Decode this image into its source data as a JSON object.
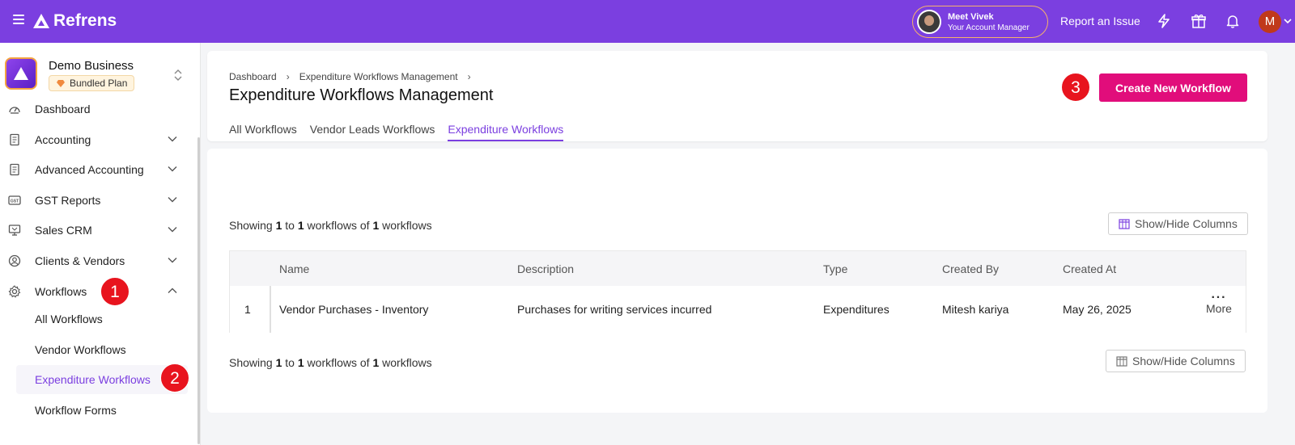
{
  "topbar": {
    "brand": "Refrens",
    "manager_name": "Meet Vivek",
    "manager_role": "Your Account Manager",
    "report_label": "Report an Issue",
    "user_initial": "M",
    "accent_color": "#7b3fe0"
  },
  "sidebar": {
    "business_name": "Demo Business",
    "plan_label": "Bundled Plan",
    "items": [
      {
        "label": "Dashboard",
        "icon": "dashboard-icon"
      },
      {
        "label": "Accounting",
        "icon": "document-icon"
      },
      {
        "label": "Advanced Accounting",
        "icon": "document-icon"
      },
      {
        "label": "GST Reports",
        "icon": "gst-icon"
      },
      {
        "label": "Sales CRM",
        "icon": "monitor-icon"
      },
      {
        "label": "Clients & Vendors",
        "icon": "user-circle-icon"
      },
      {
        "label": "Workflows",
        "icon": "gear-icon"
      }
    ],
    "workflow_subitems": [
      {
        "label": "All Workflows"
      },
      {
        "label": "Vendor Workflows"
      },
      {
        "label": "Expenditure Workflows"
      },
      {
        "label": "Workflow Forms"
      }
    ]
  },
  "markers": [
    "1",
    "2",
    "3"
  ],
  "header": {
    "breadcrumbs": [
      "Dashboard",
      "Expenditure Workflows Management"
    ],
    "title": "Expenditure Workflows Management",
    "tabs": [
      "All Workflows",
      "Vendor Leads Workflows",
      "Expenditure Workflows"
    ],
    "active_tab": "Expenditure Workflows",
    "create_button": "Create New Workflow"
  },
  "content": {
    "showing_prefix": "Showing",
    "showing_from": "1",
    "showing_to_word": "to",
    "showing_to": "1",
    "showing_of_word": "workflows of",
    "showing_total": "1",
    "showing_suffix": "workflows",
    "columns_button": "Show/Hide Columns",
    "table": {
      "headers": [
        "Name",
        "Description",
        "Type",
        "Created By",
        "Created At"
      ],
      "rows": [
        {
          "index": "1",
          "name": "Vendor Purchases - Inventory",
          "description": "Purchases for writing services incurred",
          "type": "Expenditures",
          "created_by": "Mitesh kariya",
          "created_at": "May 26, 2025",
          "more_label": "More"
        }
      ]
    }
  }
}
